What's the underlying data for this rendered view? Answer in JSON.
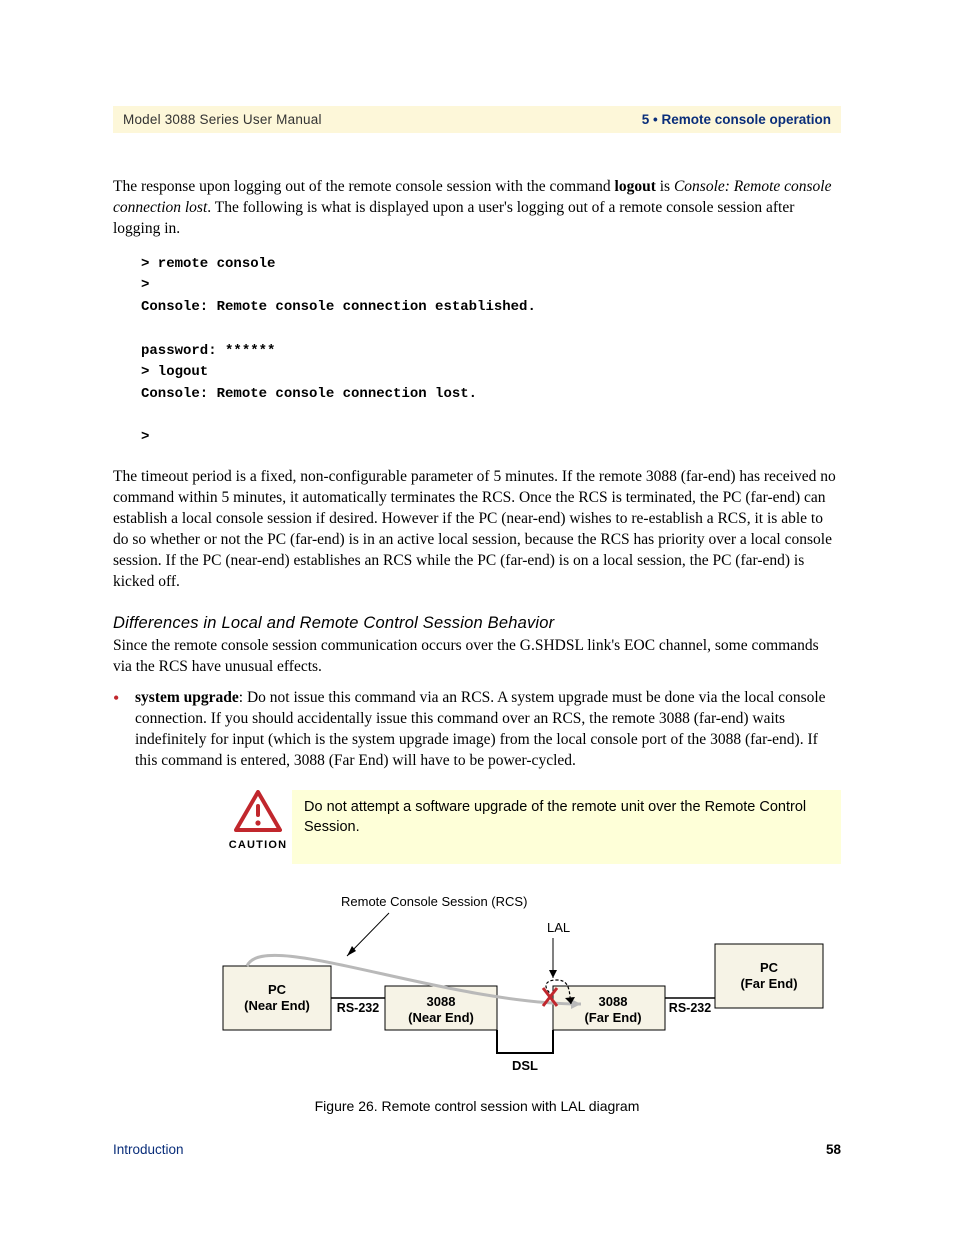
{
  "header": {
    "left": "Model 3088 Series User Manual",
    "right": "5 • Remote console operation"
  },
  "p1": {
    "t1": "The response upon logging out of the remote console session with the command ",
    "logout": "logout",
    "t2": " is ",
    "resp": "Console: Remote console connection lost",
    "t3": ". The following is what is displayed upon a user's logging out of a remote console session after logging in."
  },
  "code": "> remote console\n>\nConsole: Remote console connection established.\n\npassword: ******\n> logout\nConsole: Remote console connection lost.\n\n>",
  "p2": "The timeout period is a fixed, non-configurable parameter of 5 minutes. If the remote 3088 (far-end) has received no command within 5 minutes, it automatically terminates the RCS. Once the RCS is terminated, the PC (far-end) can establish a local console session if desired. However if the PC (near-end) wishes to re-establish a RCS, it is able to do so whether or not the PC (far-end) is in an active local session, because the RCS has priority over a local console session. If the PC (near-end) establishes an RCS while the PC (far-end) is on a local session, the PC (far-end) is kicked off.",
  "h1": "Differences in Local and Remote Control Session Behavior",
  "p3": "Since the remote console session communication occurs over the G.SHDSL link's EOC channel, some commands via the RCS have unusual effects.",
  "bullet": {
    "lead": "system upgrade",
    "text": ": Do not issue this command via an RCS. A system upgrade must be done via the local console connection. If you should accidentally issue this command over an RCS, the remote 3088 (far-end) waits indefinitely for input (which is the system upgrade image) from the local console port of the 3088 (far-end). If this command is entered, 3088 (Far End) will have to be power-cycled."
  },
  "caution": {
    "label": "CAUTION",
    "text": "Do not attempt a software upgrade of the remote unit over the Remote Control Session."
  },
  "diagram": {
    "rcs": "Remote Console Session (RCS)",
    "lal": "LAL",
    "pc_near_l1": "PC",
    "pc_near_l2": "(Near End)",
    "pc_far_l1": "PC",
    "pc_far_l2": "(Far End)",
    "n3088_l1": "3088",
    "n3088_l2": "(Near End)",
    "f3088_l1": "3088",
    "f3088_l2": "(Far End)",
    "rs232": "RS-232",
    "dsl": "DSL"
  },
  "figcap": "Figure 26. Remote control session with LAL diagram",
  "footer": {
    "left": "Introduction",
    "right": "58"
  }
}
